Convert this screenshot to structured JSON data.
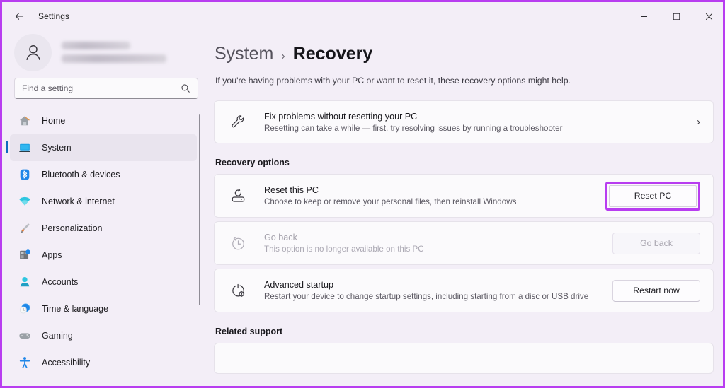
{
  "titlebar": {
    "back_label": "back-arrow",
    "app_title": "Settings",
    "minimize": "–",
    "maximize": "□",
    "close": "✕"
  },
  "sidebar": {
    "account": {
      "name_hidden": "",
      "email_hidden": ""
    },
    "search": {
      "placeholder": "Find a setting",
      "value": ""
    },
    "items": [
      {
        "label": "Home",
        "icon": "home-icon",
        "selected": false
      },
      {
        "label": "System",
        "icon": "system-icon",
        "selected": true
      },
      {
        "label": "Bluetooth & devices",
        "icon": "bluetooth-icon",
        "selected": false
      },
      {
        "label": "Network & internet",
        "icon": "network-icon",
        "selected": false
      },
      {
        "label": "Personalization",
        "icon": "personalization-icon",
        "selected": false
      },
      {
        "label": "Apps",
        "icon": "apps-icon",
        "selected": false
      },
      {
        "label": "Accounts",
        "icon": "accounts-icon",
        "selected": false
      },
      {
        "label": "Time & language",
        "icon": "time-language-icon",
        "selected": false
      },
      {
        "label": "Gaming",
        "icon": "gaming-icon",
        "selected": false
      },
      {
        "label": "Accessibility",
        "icon": "accessibility-icon",
        "selected": false
      }
    ]
  },
  "main": {
    "breadcrumb": {
      "parent": "System",
      "separator": "›",
      "current": "Recovery"
    },
    "intro": "If you're having problems with your PC or want to reset it, these recovery options might help.",
    "troubleshoot_card": {
      "icon": "wrench-icon",
      "title": "Fix problems without resetting your PC",
      "subtitle": "Resetting can take a while — first, try resolving issues by running a troubleshooter",
      "chevron": "›"
    },
    "recovery_options_heading": "Recovery options",
    "options": [
      {
        "icon": "reset-pc-icon",
        "title": "Reset this PC",
        "subtitle": "Choose to keep or remove your personal files, then reinstall Windows",
        "button": "Reset PC",
        "disabled": false,
        "highlighted": true
      },
      {
        "icon": "go-back-clock-icon",
        "title": "Go back",
        "subtitle": "This option is no longer available on this PC",
        "button": "Go back",
        "disabled": true,
        "highlighted": false
      },
      {
        "icon": "advanced-startup-icon",
        "title": "Advanced startup",
        "subtitle": "Restart your device to change startup settings, including starting from a disc or USB drive",
        "button": "Restart now",
        "disabled": false,
        "highlighted": false
      }
    ],
    "related_support_heading": "Related support"
  },
  "colors": {
    "highlight": "#b83df0",
    "accent_selected": "#0f6cbd",
    "page_background": "#f3eef7",
    "card_background": "#fbfafc"
  }
}
